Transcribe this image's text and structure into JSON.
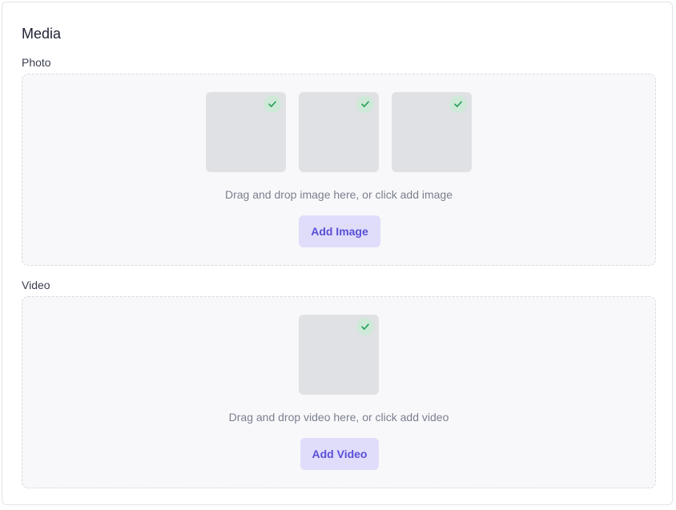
{
  "card": {
    "title": "Media"
  },
  "photo": {
    "label": "Photo",
    "hint": "Drag and drop image here, or click add image",
    "button_label": "Add Image",
    "thumbnails": 3
  },
  "video": {
    "label": "Video",
    "hint": "Drag and drop video here, or click add video",
    "button_label": "Add Video",
    "thumbnails": 1
  },
  "colors": {
    "accent": "#5b4fd6",
    "accent_bg": "#e0ddfb",
    "check": "#1f9d55",
    "check_bg": "#cfe9d8"
  },
  "icons": {
    "selected": "check-icon"
  }
}
